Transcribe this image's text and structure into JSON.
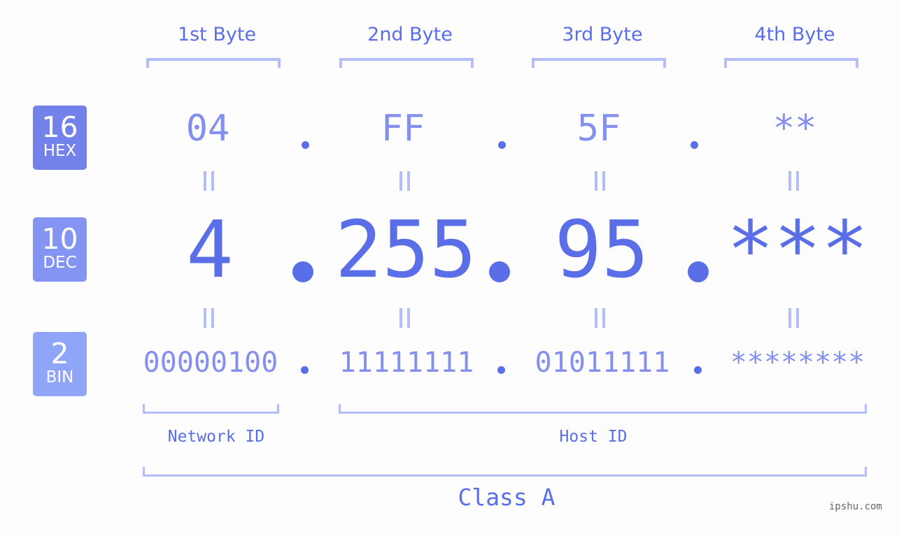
{
  "bytes": [
    {
      "header": "1st Byte",
      "hex": "04",
      "dec": "4",
      "bin": "00000100"
    },
    {
      "header": "2nd Byte",
      "hex": "FF",
      "dec": "255",
      "bin": "11111111"
    },
    {
      "header": "3rd Byte",
      "hex": "5F",
      "dec": "95",
      "bin": "01011111"
    },
    {
      "header": "4th Byte",
      "hex": "**",
      "dec": "***",
      "bin": "********"
    }
  ],
  "badges": {
    "hex": {
      "num": "16",
      "label": "HEX",
      "color": "#7282ea"
    },
    "dec": {
      "num": "10",
      "label": "DEC",
      "color": "#8494f2"
    },
    "bin": {
      "num": "2",
      "label": "BIN",
      "color": "#8fa6f8"
    }
  },
  "network_id_label": "Network ID",
  "host_id_label": "Host ID",
  "class_label": "Class A",
  "watermark": "ipshu.com",
  "colors": {
    "accent": "#5a6ee8",
    "light": "#8490ee",
    "bracket": "#b3bdf8"
  }
}
